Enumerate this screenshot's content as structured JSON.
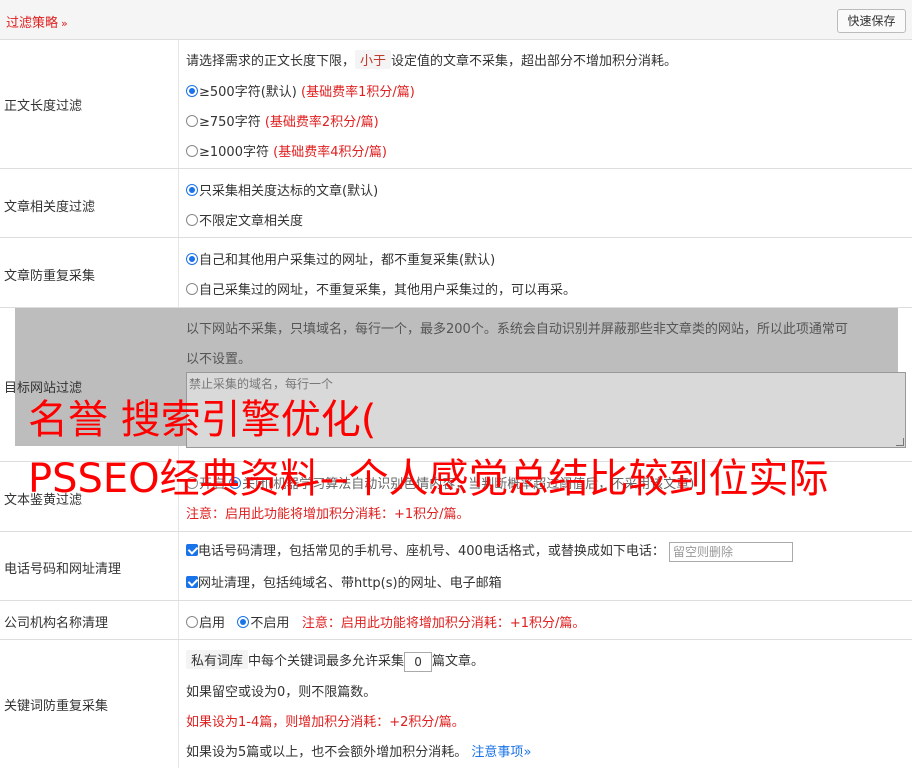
{
  "header": {
    "title": "过滤策略",
    "title_chevron": "»",
    "quick_save": "快速保存"
  },
  "length_filter": {
    "label": "正文长度过滤",
    "desc_pre": "请选择需求的正文长度下限，",
    "desc_tag": "小于",
    "desc_post": "设定值的文章不采集，超出部分不增加积分消耗。",
    "options": [
      {
        "text": "≥500字符(默认)",
        "note": "(基础费率1积分/篇)",
        "checked": true
      },
      {
        "text": "≥750字符",
        "note": "(基础费率2积分/篇)",
        "checked": false
      },
      {
        "text": "≥1000字符",
        "note": "(基础费率4积分/篇)",
        "checked": false
      }
    ]
  },
  "relevance_filter": {
    "label": "文章相关度过滤",
    "options": [
      {
        "text": "只采集相关度达标的文章(默认)",
        "checked": true
      },
      {
        "text": "不限定文章相关度",
        "checked": false
      }
    ]
  },
  "dedupe": {
    "label": "文章防重复采集",
    "options": [
      {
        "text": "自己和其他用户采集过的网址，都不重复采集(默认)",
        "checked": true
      },
      {
        "text": "自己采集过的网址，不重复采集，其他用户采集过的，可以再采。",
        "checked": false
      }
    ]
  },
  "site_filter": {
    "label": "目标网站过滤",
    "desc_line1": "以下网站不采集，只填域名，每行一个，最多200个。系统会自动识别并屏蔽那些非文章类的网站，所以此项通常可",
    "desc_line2": "以不设置。",
    "placeholder": "禁止采集的域名，每行一个"
  },
  "porn_filter": {
    "label": "文本鉴黄过滤",
    "line1_pre": "开启",
    "line1_mid": "关闭",
    "line1_post": "(机器学习算法自动识别色情内容，当判断概率超过阈值后，不采用该文章)",
    "note": "注意：启用此功能将增加积分消耗：+1积分/篇。"
  },
  "phone_cleanup": {
    "label": "电话号码和网址清理",
    "line1": "电话号码清理，包括常见的手机号、座机号、400电话格式，或替换成如下电话：",
    "phone_placeholder": "留空则删除",
    "line2": "网址清理，包括纯域名、带http(s)的网址、电子邮箱"
  },
  "org_cleanup": {
    "label": "公司机构名称清理",
    "enable": "启用",
    "disable": "不启用",
    "note": "注意：启用此功能将增加积分消耗：+1积分/篇。"
  },
  "keyword_dedupe": {
    "label": "关键词防重复采集",
    "tag": "私有词库",
    "line1_mid": "中每个关键词最多允许采集",
    "count_value": "0",
    "line1_post": "篇文章。",
    "line2": "如果留空或设为0，则不限篇数。",
    "line3": "如果设为1-4篇，则增加积分消耗：+2积分/篇。",
    "line4": "如果设为5篇或以上，也不会额外增加积分消耗。",
    "notice_link": "注意事项",
    "notice_chevron": "»"
  },
  "watermark": {
    "line1": "名誉 搜索引擎优化(",
    "line2": "PSSEO经典资料--个人感觉总结比较到位实际"
  },
  "colors": {
    "accent_red": "#e02020",
    "link_blue": "#1a73e8",
    "watermark_red": "#ff0000"
  }
}
